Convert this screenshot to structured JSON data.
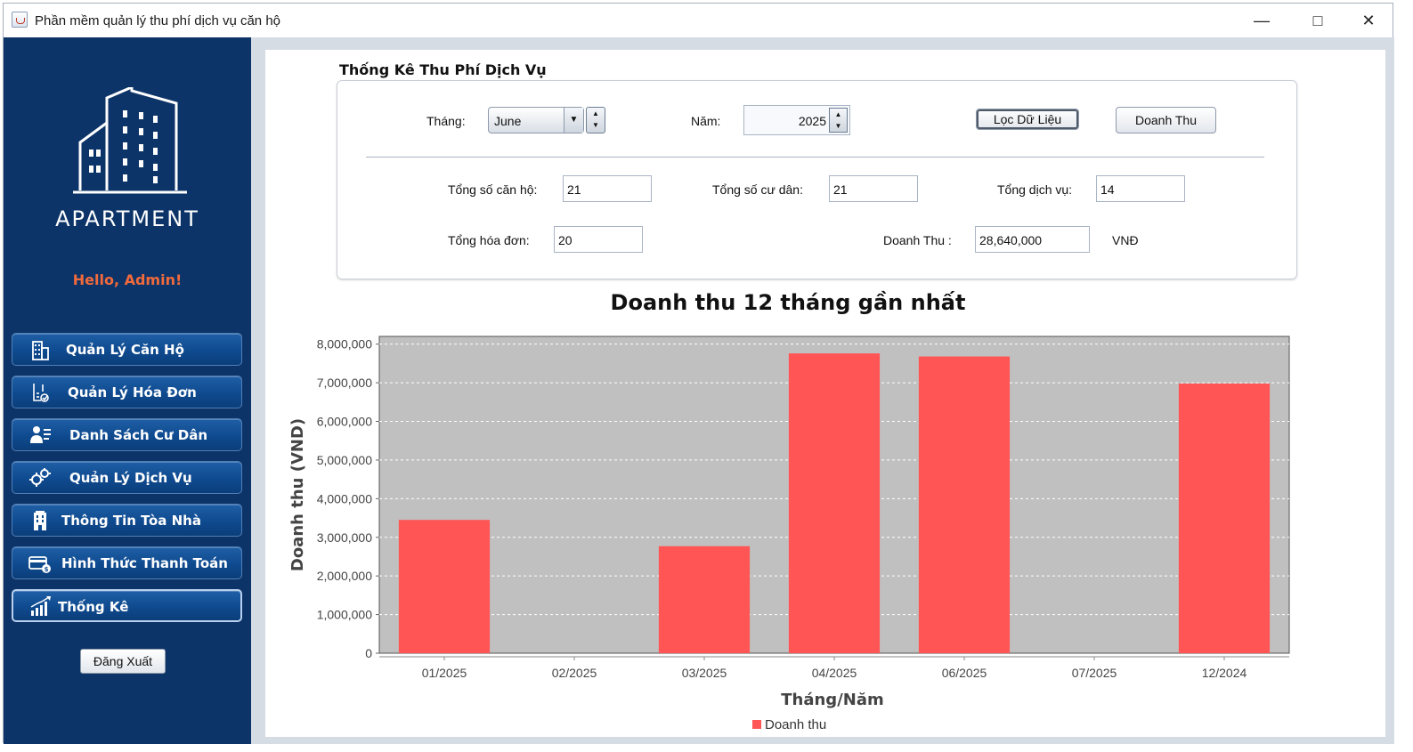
{
  "window": {
    "title": "Phần mềm quản lý thu phí dịch vụ căn hộ",
    "minimize_icon": "minimize-icon",
    "maximize_icon": "maximize-icon",
    "close_icon": "close-icon"
  },
  "sidebar": {
    "logo_text": "APARTMENT",
    "greeting": "Hello, Admin!",
    "items": [
      {
        "label": "Quản Lý Căn Hộ",
        "icon": "building-icon"
      },
      {
        "label": "Quản Lý Hóa Đơn",
        "icon": "invoice-icon"
      },
      {
        "label": "Danh Sách Cư Dân",
        "icon": "resident-list-icon"
      },
      {
        "label": "Quản Lý Dịch Vụ",
        "icon": "gears-icon"
      },
      {
        "label": "Thông Tin Tòa Nhà",
        "icon": "tower-icon"
      },
      {
        "label": "Hình Thức Thanh Toán",
        "icon": "card-icon"
      },
      {
        "label": "Thống Kê",
        "icon": "bar-chart-icon"
      }
    ],
    "logout_label": "Đăng Xuất"
  },
  "stats": {
    "section_title": "Thống Kê Thu Phí Dịch Vụ",
    "month_label": "Tháng:",
    "month_value": "June",
    "year_label": "Năm:",
    "year_value": "2025",
    "filter_button": "Lọc Dữ Liệu",
    "revenue_button": "Doanh Thu",
    "total_apartments_label": "Tổng số căn hộ:",
    "total_apartments": "21",
    "total_residents_label": "Tổng số cư dân:",
    "total_residents": "21",
    "total_services_label": "Tổng dịch vụ:",
    "total_services": "14",
    "total_invoices_label": "Tổng hóa đơn:",
    "total_invoices": "20",
    "revenue_label": "Doanh Thu :",
    "revenue_value": "28,640,000",
    "currency": "VNĐ"
  },
  "colors": {
    "sidebar_bg": "#0d3468",
    "greeting": "#f06a3c",
    "bar": "#ff5555",
    "plot_bg": "#c0c0c0"
  },
  "chart_data": {
    "type": "bar",
    "title": "Doanh thu 12 tháng gần nhất",
    "xlabel": "Tháng/Năm",
    "ylabel": "Doanh thu (VND)",
    "categories": [
      "01/2025",
      "02/2025",
      "03/2025",
      "04/2025",
      "06/2025",
      "07/2025",
      "12/2024"
    ],
    "series": [
      {
        "name": "Doanh thu",
        "values": [
          3450000,
          0,
          2770000,
          7760000,
          7680000,
          0,
          6980000
        ]
      }
    ],
    "ylim": [
      0,
      8200000
    ],
    "yticks": [
      0,
      1000000,
      2000000,
      3000000,
      4000000,
      5000000,
      6000000,
      7000000,
      8000000
    ],
    "ytick_labels": [
      "0",
      "1,000,000",
      "2,000,000",
      "3,000,000",
      "4,000,000",
      "5,000,000",
      "6,000,000",
      "7,000,000",
      "8,000,000"
    ],
    "grid": true,
    "legend": "bottom"
  }
}
